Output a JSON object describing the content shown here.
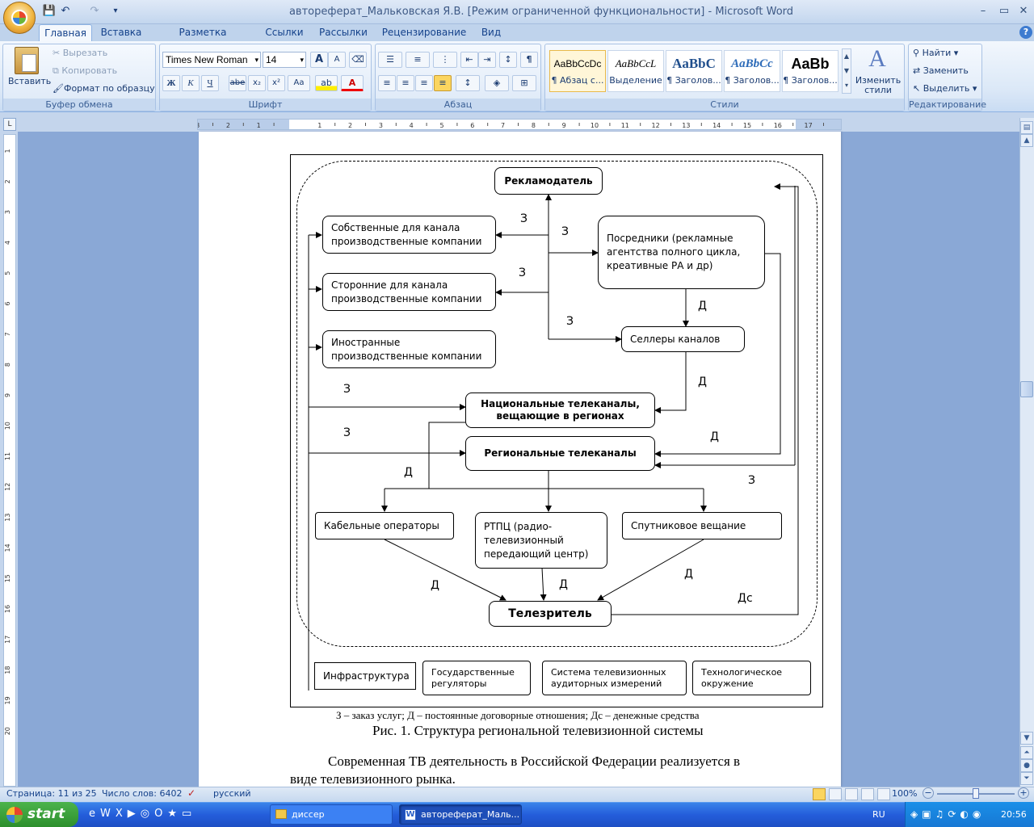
{
  "window": {
    "title": "автореферат_Мальковская Я.В. [Режим ограниченной функциональности] - Microsoft Word",
    "qat_dropdown": "▾"
  },
  "tabs": [
    "Главная",
    "Вставка",
    "Разметка страницы",
    "Ссылки",
    "Рассылки",
    "Рецензирование",
    "Вид"
  ],
  "clipboard": {
    "paste": "Вставить",
    "cut": "Вырезать",
    "copy": "Копировать",
    "format_painter": "Формат по образцу",
    "label": "Буфер обмена"
  },
  "font": {
    "name": "Times New Roman",
    "size": "14",
    "label": "Шрифт",
    "bold": "Ж",
    "italic": "К",
    "underline": "Ч",
    "strike": "abe",
    "sub": "x₂",
    "sup": "x²",
    "case": "Aa",
    "grow": "A",
    "shrink": "A"
  },
  "paragraph": {
    "label": "Абзац",
    "pilcrow": "¶"
  },
  "styles": {
    "label": "Стили",
    "items": [
      {
        "sample": "AaBbCcDc",
        "name": "¶ Абзац с..."
      },
      {
        "sample": "AaBbCcL",
        "name": "Выделение"
      },
      {
        "sample": "AaBbC",
        "name": "¶ Заголов..."
      },
      {
        "sample": "AaBbCc",
        "name": "¶ Заголов..."
      },
      {
        "sample": "AaBb",
        "name": "¶ Заголов..."
      }
    ],
    "change": "Изменить стили"
  },
  "editing": {
    "label": "Редактирование",
    "find": "Найти",
    "replace": "Заменить",
    "select": "Выделить"
  },
  "ruler": {
    "ticks": [
      "3",
      "2",
      "1",
      "1",
      "2",
      "3",
      "4",
      "5",
      "6",
      "7",
      "8",
      "9",
      "10",
      "11",
      "12",
      "13",
      "14",
      "15",
      "16",
      "17"
    ],
    "vticks": [
      "1",
      "2",
      "3",
      "4",
      "5",
      "6",
      "7",
      "8",
      "9",
      "10",
      "11",
      "12",
      "13",
      "14",
      "15",
      "16",
      "17",
      "18",
      "19",
      "20"
    ],
    "corner": "L"
  },
  "diagram": {
    "nodes": {
      "advertiser": "Рекламодатель",
      "own_companies": "Собственные для канала производственные компании",
      "third_companies": "Сторонние для канала производственные компании",
      "foreign_companies": "Иностранные производственные компании",
      "intermediaries": "Посредники (рекламные агентства полного цикла, креативные РА и др)",
      "sellers": "Селлеры каналов",
      "national": "Национальные телеканалы, вещающие в регионах",
      "regional": "Региональные телеканалы",
      "cable": "Кабельные операторы",
      "rtpc": "РТПЦ (радио-телевизионный передающий центр)",
      "satellite": "Спутниковое вещание",
      "viewer": "Телезритель",
      "infrastructure": "Инфраструктура",
      "regulators": "Государственные регуляторы",
      "measurement": "Система телевизионных аудиторных измерений",
      "tech_env": "Технологическое окружение"
    },
    "edge_labels": {
      "z": "З",
      "d": "Д",
      "ds": "Дс"
    },
    "legend": "З – заказ услуг; Д – постоянные договорные отношения; Дс – денежные средства",
    "caption": "Рис. 1. Структура региональной телевизионной системы"
  },
  "body_text": {
    "line1": "Современная ТВ деятельность в Российской Федерации реализуется в",
    "line2": "виде телевизионного рынка."
  },
  "status": {
    "page": "Страница: 11 из 25",
    "words": "Число слов: 6402",
    "language": "русский",
    "zoom": "100%"
  },
  "taskbar": {
    "start": "start",
    "tasks": [
      "диссер",
      "автореферат_Маль..."
    ],
    "lang": "RU",
    "time": "20:56"
  }
}
